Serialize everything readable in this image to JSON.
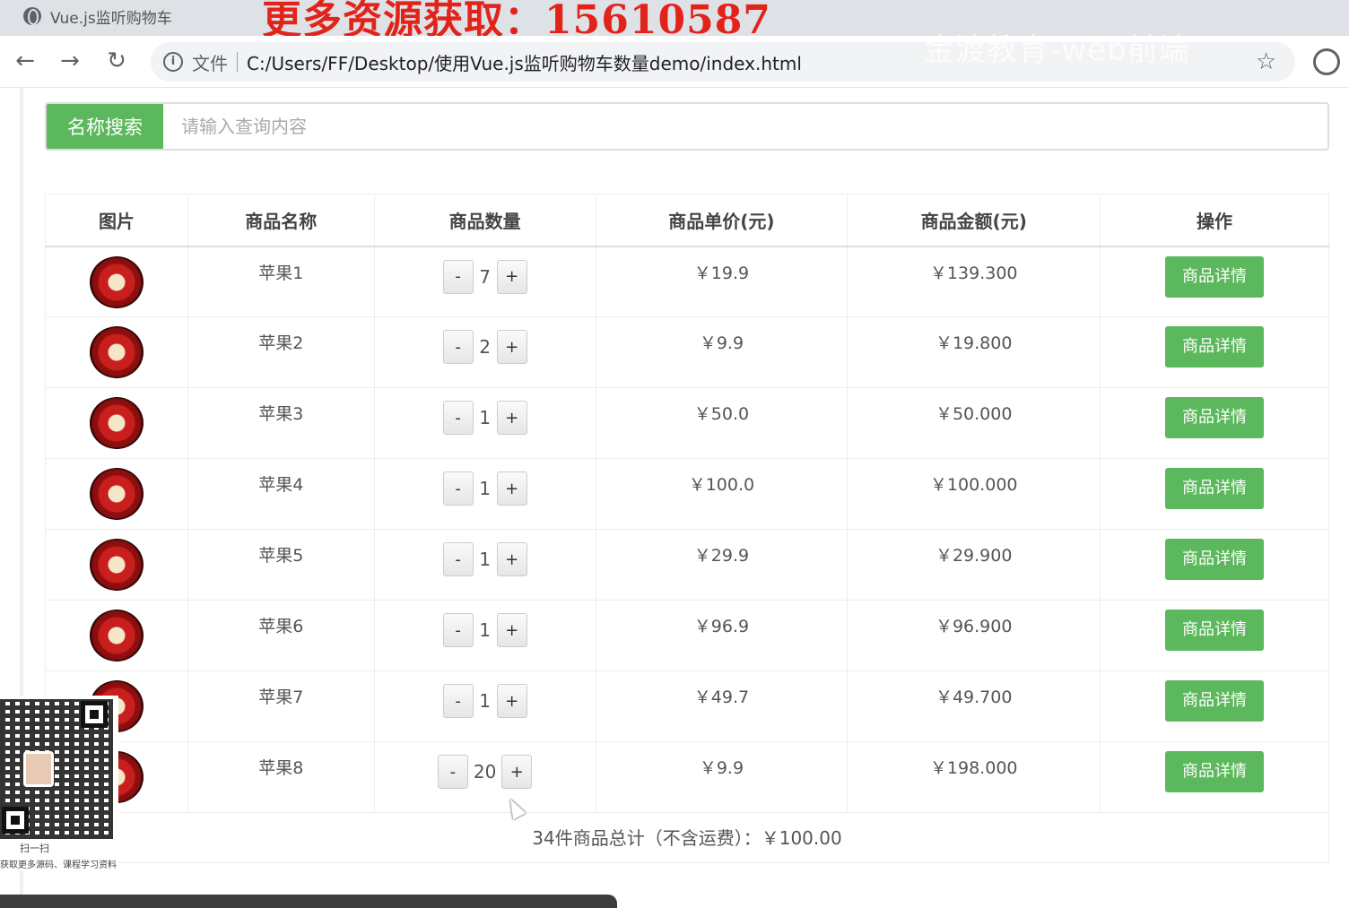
{
  "browser": {
    "tab_title": "Vue.js监听购物车",
    "promo_text": "更多资源获取：15610587",
    "watermark": "金渡教育-web前端",
    "back_icon": "←",
    "forward_icon": "→",
    "reload_icon": "↻",
    "info_icon": "i",
    "file_label": "文件",
    "url": "C:/Users/FF/Desktop/使用Vue.js监听购物车数量demo/index.html",
    "star_icon": "☆"
  },
  "search": {
    "label": "名称搜索",
    "placeholder": "请输入查询内容",
    "value": ""
  },
  "table": {
    "headers": [
      "图片",
      "商品名称",
      "商品数量",
      "商品单价(元)",
      "商品金额(元)",
      "操作"
    ],
    "rows": [
      {
        "name": "苹果1",
        "qty": "7",
        "price": "￥19.9",
        "amount": "￥139.300"
      },
      {
        "name": "苹果2",
        "qty": "2",
        "price": "￥9.9",
        "amount": "￥19.800"
      },
      {
        "name": "苹果3",
        "qty": "1",
        "price": "￥50.0",
        "amount": "￥50.000"
      },
      {
        "name": "苹果4",
        "qty": "1",
        "price": "￥100.0",
        "amount": "￥100.000"
      },
      {
        "name": "苹果5",
        "qty": "1",
        "price": "￥29.9",
        "amount": "￥29.900"
      },
      {
        "name": "苹果6",
        "qty": "1",
        "price": "￥96.9",
        "amount": "￥96.900"
      },
      {
        "name": "苹果7",
        "qty": "1",
        "price": "￥49.7",
        "amount": "￥49.700"
      },
      {
        "name": "苹果8",
        "qty": "20",
        "price": "￥9.9",
        "amount": "￥198.000"
      }
    ],
    "minus_label": "-",
    "plus_label": "+",
    "detail_label": "商品详情",
    "total": "34件商品总计（不含运费）：￥100.00"
  },
  "qr": {
    "caption_line1": "扫一扫",
    "caption_line2": "获取更多源码、课程学习资料"
  },
  "colors": {
    "accent_green": "#5cb85c",
    "promo_red": "#e2231a"
  }
}
